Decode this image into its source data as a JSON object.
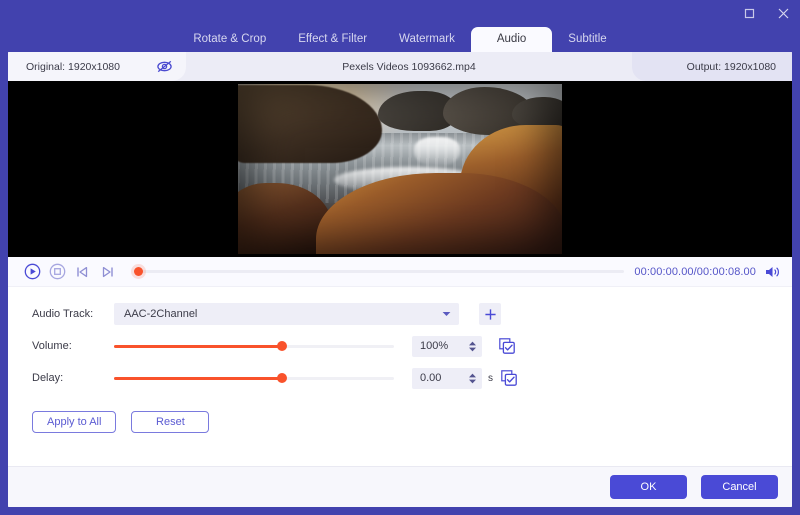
{
  "window": {
    "controls": [
      {
        "name": "maximize-button",
        "icon": "square-icon"
      },
      {
        "name": "close-button",
        "icon": "close-icon"
      }
    ]
  },
  "tabs": [
    {
      "label": "Rotate & Crop",
      "active": false
    },
    {
      "label": "Effect & Filter",
      "active": false
    },
    {
      "label": "Watermark",
      "active": false
    },
    {
      "label": "Audio",
      "active": true
    },
    {
      "label": "Subtitle",
      "active": false
    }
  ],
  "info_bar": {
    "original_label": "Original: 1920x1080",
    "toggle_preview_icon": "eye-slash-icon",
    "file_name": "Pexels Videos 1093662.mp4",
    "output_label": "Output: 1920x1080"
  },
  "transport": {
    "play_icon": "play-circle-icon",
    "stop_icon": "stop-circle-icon",
    "prev_icon": "previous-frame-icon",
    "next_icon": "next-frame-icon",
    "timecode": "00:00:00.00/00:00:08.00",
    "current_time": "00:00:00.00",
    "total_time": "00:00:08.00",
    "progress_percent": 0,
    "volume_icon": "speaker-icon"
  },
  "form": {
    "audio_track": {
      "label": "Audio Track:",
      "value": "AAC-2Channel",
      "caret_icon": "chevron-down-icon",
      "add_icon": "plus-icon"
    },
    "volume": {
      "label": "Volume:",
      "value": "100%",
      "slider_percent": 60,
      "check_icon": "apply-to-all-check-icon"
    },
    "delay": {
      "label": "Delay:",
      "value": "0.00",
      "unit": "s",
      "slider_percent": 60,
      "check_icon": "apply-to-all-check-icon"
    },
    "apply_to_all_label": "Apply to All",
    "reset_label": "Reset"
  },
  "footer": {
    "ok_label": "OK",
    "cancel_label": "Cancel"
  },
  "colors": {
    "window_purple": "#4242ae",
    "accent_purple": "#4a4ad6",
    "slider_orange": "#f9522b",
    "panel_white": "#ffffff"
  }
}
